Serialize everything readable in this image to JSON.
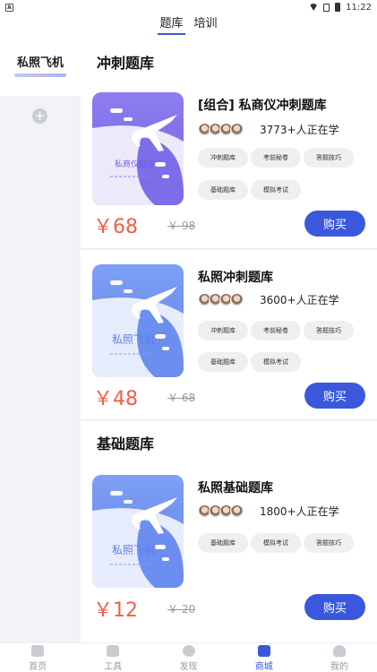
{
  "status_bar": {
    "time": "11:22",
    "app_icon_letter": "A"
  },
  "top_tabs": [
    {
      "label": "题库",
      "active": true
    },
    {
      "label": "培训",
      "active": false
    }
  ],
  "sidebar": {
    "items": [
      {
        "label": "私照飞机",
        "active": true
      }
    ],
    "add_icon": "plus-circle-icon"
  },
  "sections": [
    {
      "title": "冲刺题库"
    },
    {
      "title": "基础题库"
    }
  ],
  "products": [
    {
      "title": "[组合] 私商仪冲刺题库",
      "learners": "3773+人正在学",
      "cover_text": "私商仪题库",
      "tags": [
        "冲刺题库",
        "考前秘卷",
        "答题技巧",
        "基础题库",
        "模拟考试"
      ],
      "price": "￥68",
      "old_price": "￥ 98",
      "buy_label": "购买"
    },
    {
      "title": "私照冲刺题库",
      "learners": "3600+人正在学",
      "cover_text": "私照飞机",
      "tags": [
        "冲刺题库",
        "考前秘卷",
        "答题技巧",
        "基础题库",
        "模拟考试"
      ],
      "price": "￥48",
      "old_price": "￥ 68",
      "buy_label": "购买"
    },
    {
      "title": "私照基础题库",
      "learners": "1800+人正在学",
      "cover_text": "私照飞机",
      "tags": [
        "基础题库",
        "模拟考试",
        "答题技巧"
      ],
      "price": "￥12",
      "old_price": "￥ 20",
      "buy_label": "购买"
    }
  ],
  "bottom_nav": [
    {
      "label": "首页",
      "icon": "home-icon",
      "active": false
    },
    {
      "label": "工具",
      "icon": "toolbox-icon",
      "active": false
    },
    {
      "label": "发现",
      "icon": "discover-icon",
      "active": false
    },
    {
      "label": "商城",
      "icon": "shop-icon",
      "active": true
    },
    {
      "label": "我的",
      "icon": "profile-icon",
      "active": false
    }
  ],
  "colors": {
    "accent": "#3b58dd",
    "price": "#ef5f4a",
    "cover_purple": "#7b6ee8",
    "cover_blue": "#6b8ef0"
  }
}
